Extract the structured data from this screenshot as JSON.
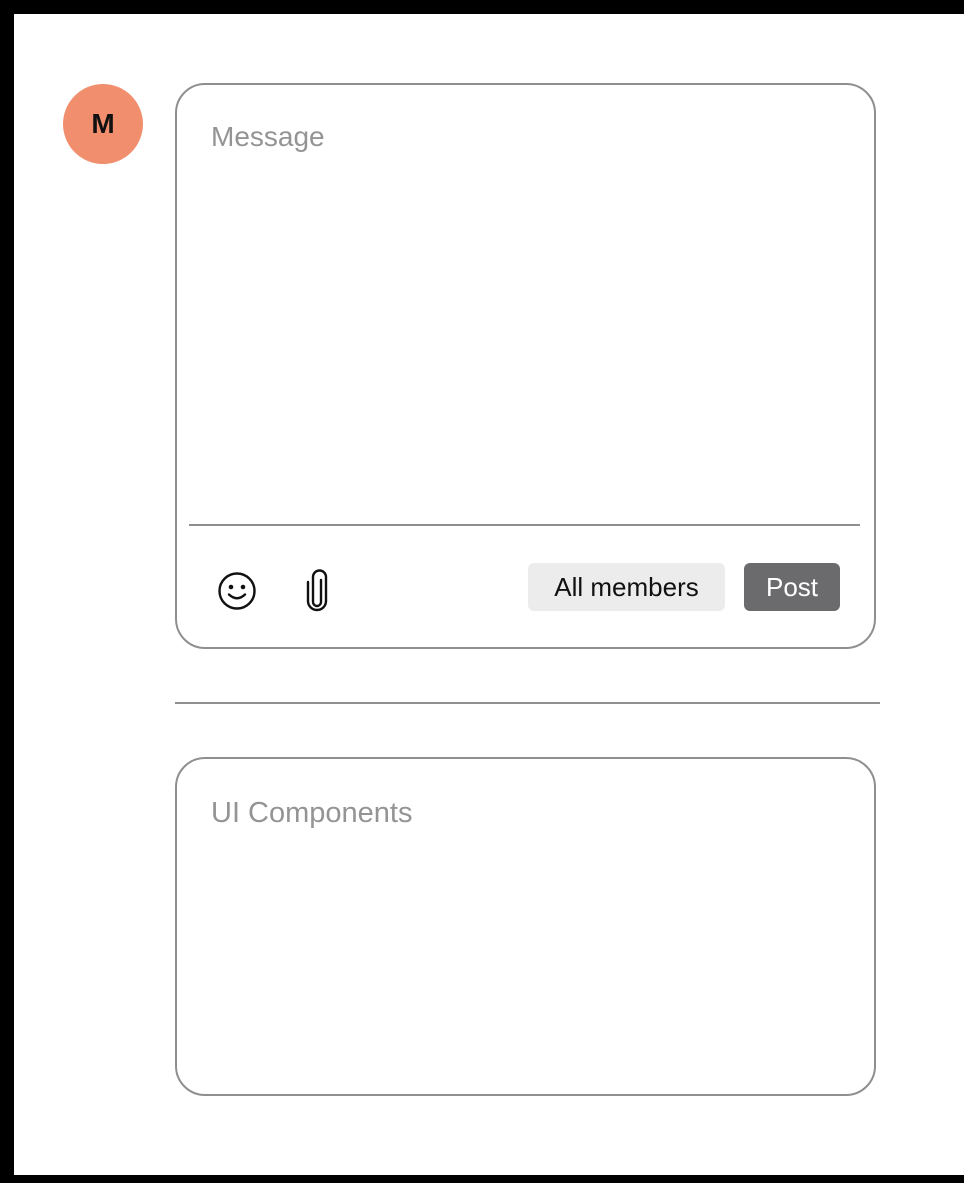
{
  "user": {
    "avatar_initial": "M",
    "avatar_color": "#f08e6d"
  },
  "composer": {
    "placeholder": "Message",
    "value": "",
    "emoji_icon": "smiley-face-icon",
    "attach_icon": "paperclip-icon",
    "audience_label": "All members",
    "post_label": "Post"
  },
  "components_panel": {
    "title": "UI Components"
  },
  "colors": {
    "border": "#8f8f8f",
    "placeholder_text": "#949494",
    "audience_bg": "#ececec",
    "post_bg": "#6b6b6d"
  }
}
